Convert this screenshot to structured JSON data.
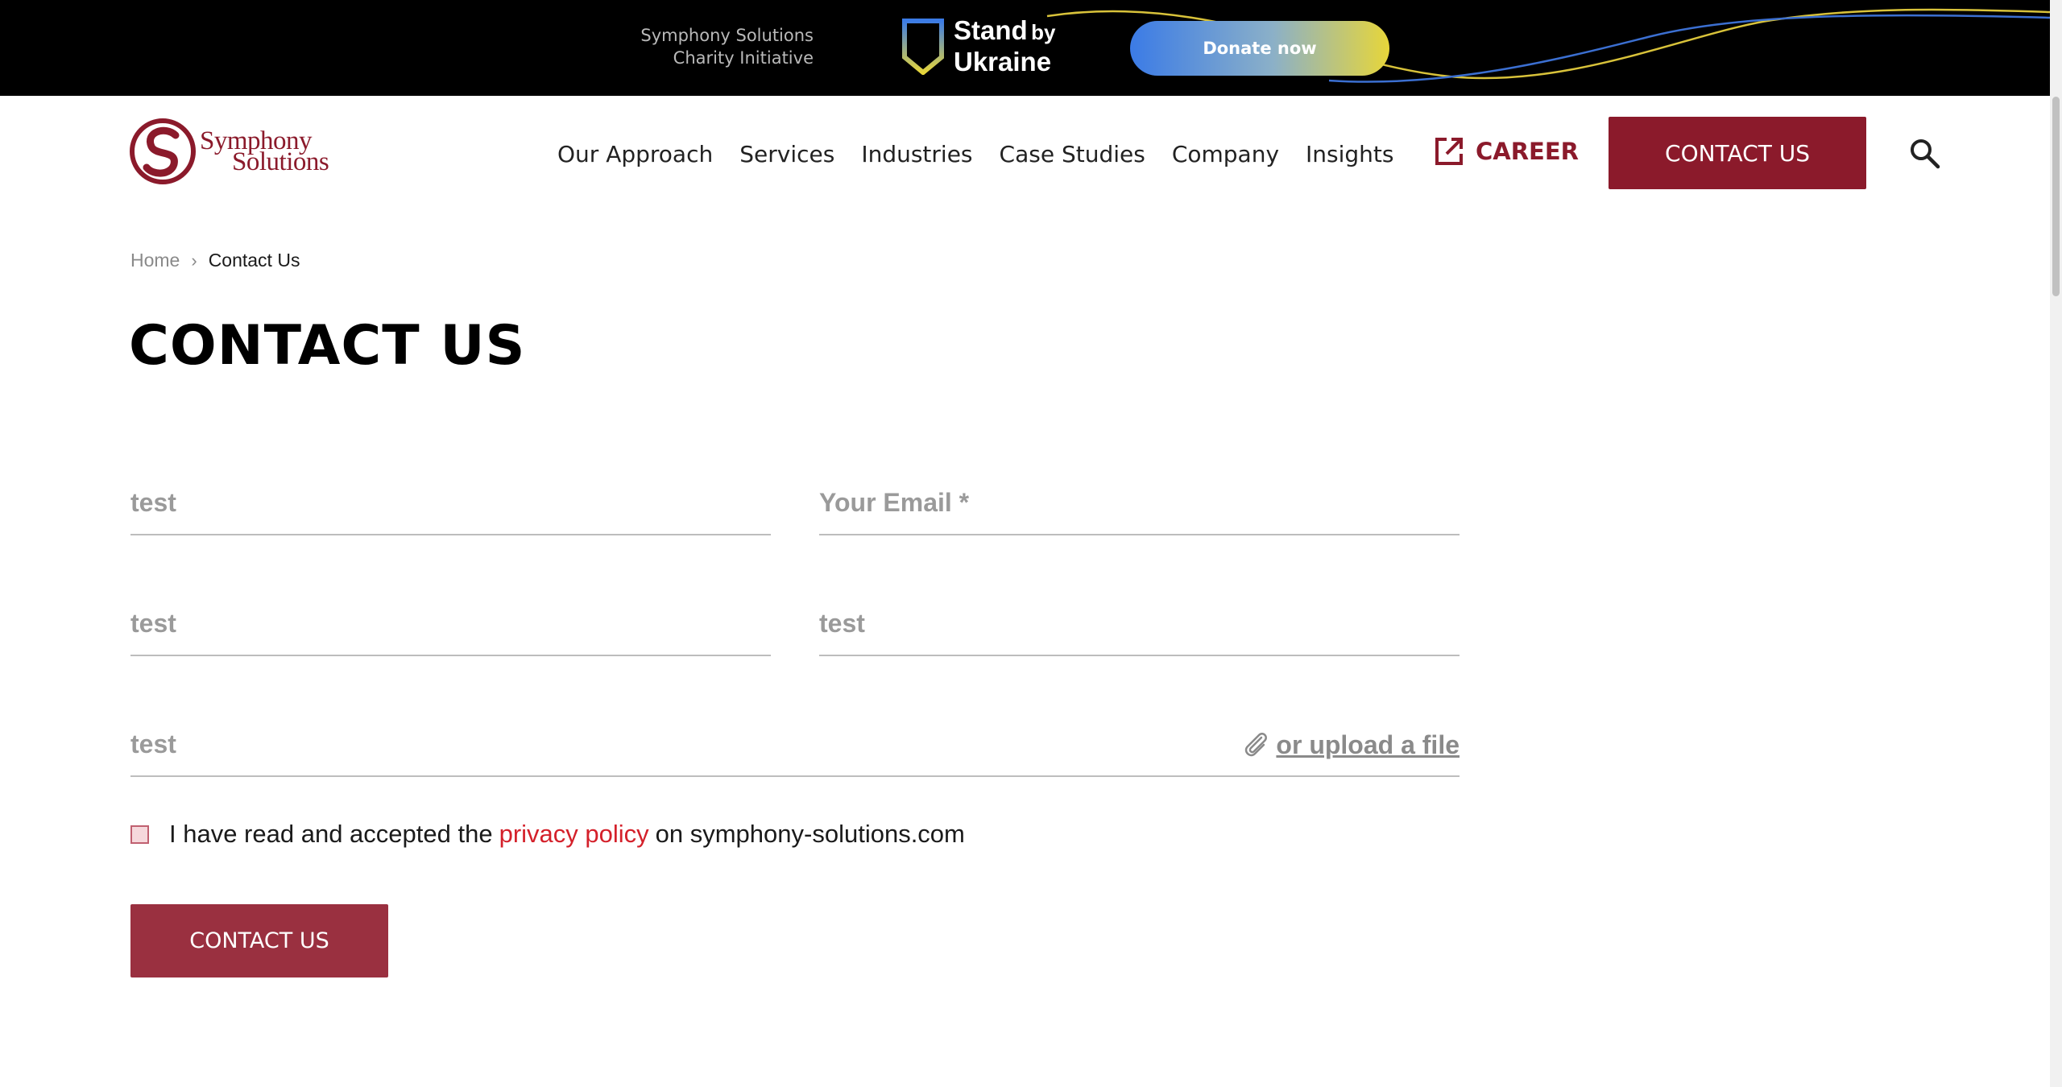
{
  "banner": {
    "charity_line1": "Symphony Solutions",
    "charity_line2": "Charity Initiative",
    "ukraine_stand": "Stand",
    "ukraine_by": "by",
    "ukraine_country": "Ukraine",
    "donate_label": "Donate now",
    "colors": {
      "blue": "#3b7be6",
      "yellow": "#e7d63a"
    }
  },
  "header": {
    "logo_line1": "Symphony",
    "logo_line2": "Solutions",
    "nav": [
      "Our Approach",
      "Services",
      "Industries",
      "Case Studies",
      "Company",
      "Insights"
    ],
    "career_label": "CAREER",
    "contact_label": "CONTACT US",
    "brand_color": "#8b1a2b"
  },
  "breadcrumb": {
    "home": "Home",
    "current": "Contact Us"
  },
  "page_title": "CONTACT US",
  "form": {
    "name_value": "test",
    "email_placeholder": "Your Email *",
    "company_value": "test",
    "phone_value": "test",
    "message_value": "test",
    "upload_label": "or upload a file",
    "consent_prefix": "I have read and accepted the",
    "privacy_link": "privacy policy",
    "consent_suffix": "on symphony-solutions.com",
    "submit_label": "CONTACT US"
  }
}
